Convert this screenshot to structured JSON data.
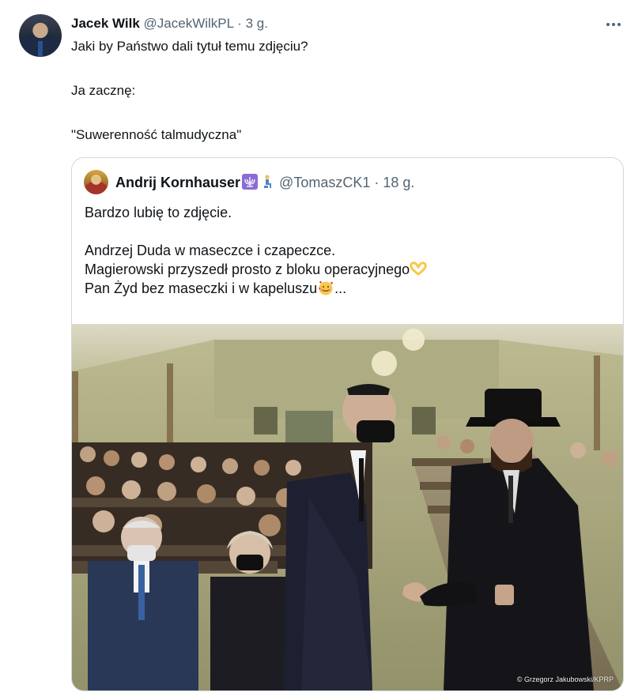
{
  "tweet": {
    "display_name": "Jacek Wilk",
    "handle": "@JacekWilkPL",
    "separator": "·",
    "time": "3 g.",
    "more_icon": "more-horizontal-icon",
    "text_lines": [
      "Jaki by Państwo dali tytuł temu zdjęciu?",
      "Ja zacznę:",
      "\"Suwerenność talmudyczna\""
    ]
  },
  "quoted_tweet": {
    "display_name": "Andrij Kornhauser",
    "name_emojis": [
      "menorah-emoji",
      "kneeling-person-emoji"
    ],
    "handle": "@TomaszCK1",
    "separator": "·",
    "time": "18 g.",
    "text_lines": [
      "Bardzo lubię to zdjęcie.",
      "Andrzej Duda w maseczce i czapeczce.",
      "Magierowski przyszedł prosto z bloku operacyjnego",
      "Pan Żyd bez maseczki i w kapeluszu",
      "..."
    ],
    "inline_emojis": [
      "heart-hands-emoji",
      "smiling-face-with-hearts-emoji"
    ],
    "photo_credit": "© Grzegorz Jakubowski/KPRP"
  },
  "colors": {
    "text_primary": "#0f1419",
    "text_secondary": "#536471",
    "border": "#cfd9de"
  }
}
